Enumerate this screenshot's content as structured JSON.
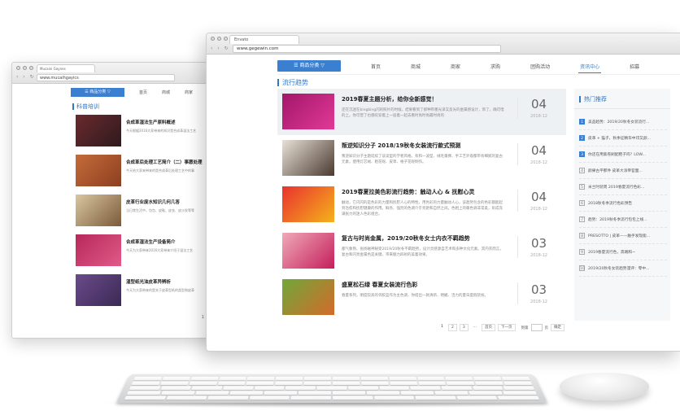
{
  "back_window": {
    "tab_title": "Mucaini Gaynes",
    "url": "www.mucaihgayics",
    "category_button": "☰ 商品分类 ▽",
    "nav": [
      "首页",
      "商城",
      "商家"
    ],
    "section_title": "科普培训",
    "articles": [
      {
        "title": "合成革湿法生产原料概述",
        "desc": "今天根据2016大家带来的知识是合成革湿法工艺",
        "colors": [
          "#6b2a2e",
          "#2d1a1e"
        ]
      },
      {
        "title": "合成革后处理工艺简介（二）事愿处理",
        "desc": "今天给大家来带来的是合成革后处理工艺中的事",
        "colors": [
          "#c56b3b",
          "#8c3f1f"
        ]
      },
      {
        "title": "皮革行业废水知识几何几答",
        "desc": "当日常生活中，包包、皮鞋、皮衣、皮沙发等等",
        "colors": [
          "#d9c6a1",
          "#7b5a3a"
        ]
      },
      {
        "title": "合成革湿法生产设备简介",
        "desc": "今天为大家带来2016大家带来介绍于湿法工艺",
        "colors": [
          "#b7285a",
          "#e05a88"
        ]
      },
      {
        "title": "湿型纸光油皮革异辨析",
        "desc": "今天为大家带来的是关于皮革型纸的类型和皮革",
        "colors": [
          "#6b4a8a",
          "#3a2a55"
        ]
      }
    ],
    "page": "1"
  },
  "front_window": {
    "tab_title": "Envato",
    "url": "www.gegewin.com",
    "category_button": "☰  商品分类  ▽",
    "nav": [
      {
        "label": "首页",
        "active": false
      },
      {
        "label": "商城",
        "active": false
      },
      {
        "label": "商家",
        "active": false
      },
      {
        "label": "求购",
        "active": false
      },
      {
        "label": "团购活动",
        "active": false
      },
      {
        "label": "资讯中心",
        "active": true
      },
      {
        "label": "招募",
        "active": false
      }
    ],
    "section_title": "流行趋势",
    "articles": [
      {
        "title": "2019春夏主题分析，给你全新感觉！",
        "desc": "还在沉迷在bingbing闪的照片的时候，结果看到了那种带墨光泽又反光的金属感设计，饰了，确可惜的上。你可曾了也感叹穿着上一层着一起去看时尚时尚最时尚的",
        "day": "04",
        "ym": "2018-12",
        "highlight": true,
        "colors": [
          "#a3166a",
          "#e03a96"
        ]
      },
      {
        "title": "叛逆知识分子 2018/19秋冬女装流行款式预测",
        "desc": "叛逆知识分子主题延续了该读型的学者风格。有和一波型、绒毛蓬撑、手工艺外观都带有细腻的复古元素，使用灯芯绒、粗花呢、皮草、格子花呢制作。",
        "day": "04",
        "ym": "2018-12",
        "highlight": false,
        "colors": [
          "#e8e1d6",
          "#4a3a30"
        ]
      },
      {
        "title": "2019春夏拉美色彩流行趋势：触动人心 & 抚慰心灵",
        "desc": "触动，它闪闪的是色彩的力量和抚慰人心的特性，用色彩的力量触动人心。该趋势包含的色彩都能起到治愈和抚慰健康的作用。鲜亮、强烈的色调介于亮艳和自然之间。色相上的暖色调非常柔，形成充满张力的迷人色彩组合。",
        "day": "04",
        "ym": "2018-12",
        "highlight": false,
        "colors": [
          "#e9322e",
          "#f5b21b"
        ]
      },
      {
        "title": "复古与时尚金属，2019/20秋冬女士内衣不羁趋势",
        "desc": "都气象熟、张扬磁神秘受2019/20秋冬不羁趋势，设计灵感源自艺术和多种文化元素。其内衣而言，复古和闪亮金属色是关键，带来魅力四射的美着效果。",
        "day": "03",
        "ym": "2018-12",
        "highlight": false,
        "colors": [
          "#f0a9b8",
          "#c41e5b"
        ]
      },
      {
        "title": "盛夏松石绿 春夏女装流行色彩",
        "desc": "春夏系列，明度较高的邻胶蓝作为主色调，你搭出一款清新、明媚、活力的夏日度假装扮。",
        "day": "03",
        "ym": "2018-12",
        "highlight": false,
        "colors": [
          "#6fa83a",
          "#d46a2a"
        ]
      }
    ],
    "pagination": {
      "pages": [
        "1",
        "2",
        "3",
        "...",
        "首页",
        "下一页"
      ],
      "goto_label": "到第",
      "page_unit": "页",
      "confirm": "确定"
    },
    "sidebar": {
      "title": "热门推荐",
      "items": [
        {
          "rank": "1",
          "label": "美品趋势：2019/20秋冬女装流行..."
        },
        {
          "rank": "2",
          "label": "皮革 + 猫子，秋季征精华中印又颜..."
        },
        {
          "rank": "3",
          "label": "你还在用紫卷刷配鞋子吗？LOW..."
        },
        {
          "rank": "4",
          "label": "颜果古平那件 皮革大派帝官面..."
        },
        {
          "rank": "5",
          "label": "米兰时装周 2019春夏流行色彩..."
        },
        {
          "rank": "6",
          "label": "2018秋冬季流行色彩预告"
        },
        {
          "rank": "7",
          "label": "趋势：2019秋冬季流行包包上线..."
        },
        {
          "rank": "8",
          "label": "PRESOTTO | 皮革——触手发现能..."
        },
        {
          "rank": "9",
          "label": "2019春夏流行色，高端和~"
        },
        {
          "rank": "10",
          "label": "2019/20秋冬女装趋势漫评：零中..."
        }
      ]
    }
  }
}
